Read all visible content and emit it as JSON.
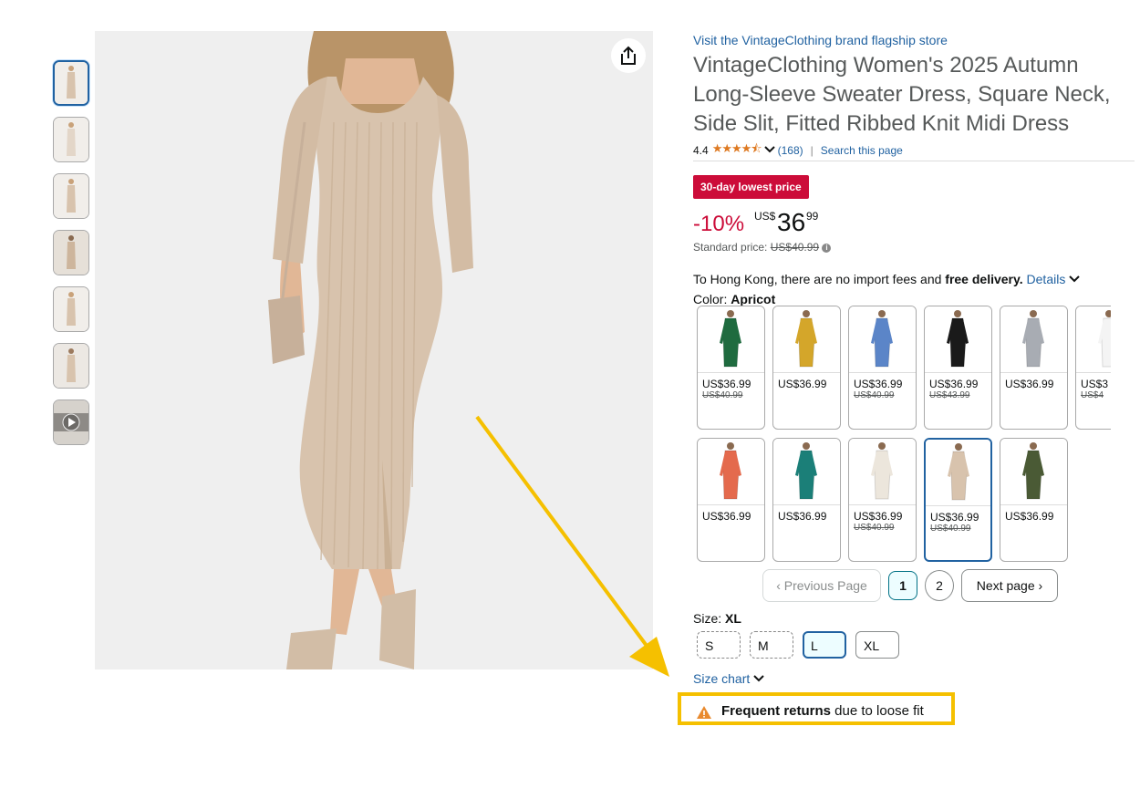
{
  "product": {
    "brand_link": "Visit the VintageClothing brand flagship store",
    "title": "VintageClothing Women's 2025 Autumn Long-Sleeve Sweater Dress, Square Neck, Side Slit, Fitted Ribbed Knit Midi Dress",
    "rating": "4.4",
    "stars_value": 4.4,
    "review_count": "(168)",
    "search_link": "Search this page"
  },
  "price": {
    "badge": "30-day lowest price",
    "discount": "-10%",
    "currency": "US$",
    "whole": "36",
    "fraction": "99",
    "standard_label": "Standard price:",
    "standard_value": "US$40.99"
  },
  "delivery": {
    "prefix": "To Hong Kong, there are no import fees and ",
    "bold": "free delivery.",
    "details_link": "Details"
  },
  "color": {
    "label": "Color:",
    "selected": "Apricot",
    "swatches": [
      {
        "color": "#1f6b3f",
        "price": "US$36.99",
        "old": "US$40.99"
      },
      {
        "color": "#d4a62a",
        "price": "US$36.99",
        "old": ""
      },
      {
        "color": "#5b85c8",
        "price": "US$36.99",
        "old": "US$40.99"
      },
      {
        "color": "#1a1a1a",
        "price": "US$36.99",
        "old": "US$43.99"
      },
      {
        "color": "#a8acb3",
        "price": "US$36.99",
        "old": ""
      },
      {
        "color": "#f4f4f4",
        "price": "US$3",
        "old": "US$4"
      },
      {
        "color": "#e46a4d",
        "price": "US$36.99",
        "old": ""
      },
      {
        "color": "#1b7f78",
        "price": "US$36.99",
        "old": ""
      },
      {
        "color": "#ece6dc",
        "price": "US$36.99",
        "old": "US$40.99"
      },
      {
        "color": "#d8c3ad",
        "price": "US$36.99",
        "old": "US$40.99"
      },
      {
        "color": "#4a5a35",
        "price": "US$36.99",
        "old": ""
      }
    ]
  },
  "pager": {
    "previous": "Previous Page",
    "page1": "1",
    "page2": "2",
    "next": "Next page"
  },
  "size": {
    "label": "Size:",
    "selected": "XL",
    "options": [
      "S",
      "M",
      "L",
      "XL"
    ],
    "size_chart": "Size chart"
  },
  "warning": {
    "bold": "Frequent returns",
    "rest": " due to loose fit"
  },
  "colors": {
    "link": "#2162a1",
    "badge": "#cc0c39",
    "highlight": "#f5c000",
    "main_image_bg": "#efefef",
    "dress": "#d8c3ad"
  }
}
